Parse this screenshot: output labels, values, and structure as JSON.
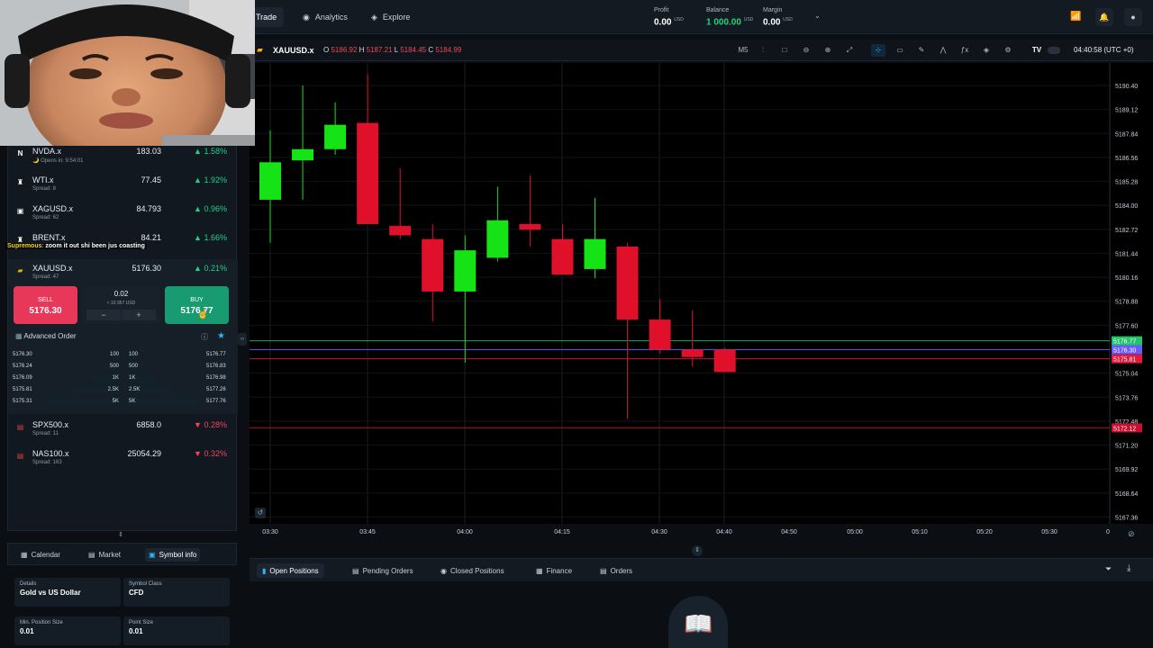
{
  "nav": {
    "tabs": [
      {
        "label": "Trade",
        "icon": "trade-icon"
      },
      {
        "label": "Analytics",
        "icon": "analytics-icon"
      },
      {
        "label": "Explore",
        "icon": "explore-icon"
      }
    ]
  },
  "account": {
    "profit_label": "Profit",
    "profit_value": "0.00",
    "profit_ccy": "USD",
    "balance_label": "Balance",
    "balance_value": "1 000.00",
    "balance_ccy": "USD",
    "margin_label": "Margin",
    "margin_value": "0.00",
    "margin_ccy": "USD"
  },
  "webcam": {
    "comment_user": "Supremous",
    "comment_text": "zoom it out shi been jus coasting"
  },
  "watchlist": [
    {
      "symbol": "NVDA.x",
      "sub": "Opens in: 9:54:01",
      "price": "183.03",
      "change": "1.58%",
      "dir": "up",
      "icon": "N"
    },
    {
      "symbol": "WTI.x",
      "sub": "Spread: 8",
      "price": "77.45",
      "change": "1.92%",
      "dir": "up",
      "icon": "♜"
    },
    {
      "symbol": "XAGUSD.x",
      "sub": "Spread: 62",
      "price": "84.793",
      "change": "0.96%",
      "dir": "up",
      "icon": "▣"
    },
    {
      "symbol": "BRENT.x",
      "sub": "",
      "price": "84.21",
      "change": "1.66%",
      "dir": "up",
      "icon": "♜"
    },
    {
      "symbol": "XAUUSD.x",
      "sub": "Spread: 47",
      "price": "5176.30",
      "change": "0.21%",
      "dir": "up",
      "icon": "▰"
    }
  ],
  "watchlist_after": [
    {
      "symbol": "SPX500.x",
      "sub": "Spread: 11",
      "price": "6858.0",
      "change": "0.28%",
      "dir": "down",
      "icon": "▤"
    },
    {
      "symbol": "NAS100.x",
      "sub": "Spread: 163",
      "price": "25054.29",
      "change": "0.32%",
      "dir": "down",
      "icon": "▤"
    }
  ],
  "trade": {
    "sell_label": "SELL",
    "sell_price": "5176.30",
    "buy_label": "BUY",
    "buy_price": "5176.77",
    "qty": "0.02",
    "qty_usd": "≈ 10 357 USD",
    "minus": "−",
    "plus": "+",
    "advanced_label": "Advanced Order"
  },
  "orderbook": [
    {
      "bid": "5176.30",
      "bvol": "100",
      "avol": "100",
      "ask": "5176.77"
    },
    {
      "bid": "5176.24",
      "bvol": "500",
      "avol": "500",
      "ask": "5176.83"
    },
    {
      "bid": "5176.09",
      "bvol": "1K",
      "avol": "1K",
      "ask": "5176.98"
    },
    {
      "bid": "5175.81",
      "bvol": "2.5K",
      "avol": "2.5K",
      "ask": "5177.26"
    },
    {
      "bid": "5175.31",
      "bvol": "5K",
      "avol": "5K",
      "ask": "5177.76"
    }
  ],
  "bottom_tabs": [
    "Calendar",
    "Market",
    "Symbol info"
  ],
  "symbol_info": {
    "details_label": "Details",
    "details_value": "Gold vs US Dollar",
    "class_label": "Symbol Class",
    "class_value": "CFD",
    "minpos_label": "Min. Position Size",
    "minpos_value": "0.01",
    "point_label": "Point Size",
    "point_value": "0.01"
  },
  "chart_header": {
    "symbol": "XAUUSD.x",
    "o_label": "O",
    "o": "5186.92",
    "h_label": "H",
    "h": "5187.21",
    "l_label": "L",
    "l": "5184.45",
    "c_label": "C",
    "c": "5184.99",
    "timeframe": "M5",
    "clock": "04:40:58 (UTC +0)"
  },
  "position_tabs": [
    "Open Positions",
    "Pending Orders",
    "Closed Positions",
    "Finance",
    "Orders"
  ],
  "chart_data": {
    "type": "candlestick",
    "x": [
      "03:30",
      "03:35",
      "03:40",
      "03:45",
      "03:50",
      "03:55",
      "04:00",
      "04:05",
      "04:10",
      "04:15",
      "04:20",
      "04:25",
      "04:30",
      "04:35",
      "04:40"
    ],
    "candles": [
      {
        "o": 5184.3,
        "h": 5188.0,
        "l": 5182.0,
        "c": 5186.3
      },
      {
        "o": 5186.4,
        "h": 5190.4,
        "l": 5184.3,
        "c": 5187.0
      },
      {
        "o": 5187.0,
        "h": 5189.5,
        "l": 5186.7,
        "c": 5188.3
      },
      {
        "o": 5188.4,
        "h": 5191.0,
        "l": 5183.5,
        "c": 5183.0
      },
      {
        "o": 5182.9,
        "h": 5186.0,
        "l": 5182.2,
        "c": 5182.4
      },
      {
        "o": 5182.2,
        "h": 5183.0,
        "l": 5177.8,
        "c": 5179.4
      },
      {
        "o": 5179.4,
        "h": 5182.4,
        "l": 5175.6,
        "c": 5181.6
      },
      {
        "o": 5181.2,
        "h": 5185.0,
        "l": 5181.0,
        "c": 5183.2
      },
      {
        "o": 5183.0,
        "h": 5185.6,
        "l": 5181.8,
        "c": 5182.7
      },
      {
        "o": 5182.2,
        "h": 5183.0,
        "l": 5181.2,
        "c": 5180.3
      },
      {
        "o": 5180.6,
        "h": 5184.4,
        "l": 5180.1,
        "c": 5182.2
      },
      {
        "o": 5181.8,
        "h": 5182.0,
        "l": 5172.6,
        "c": 5177.9
      },
      {
        "o": 5177.9,
        "h": 5179.0,
        "l": 5176.1,
        "c": 5176.3
      },
      {
        "o": 5176.3,
        "h": 5178.4,
        "l": 5175.4,
        "c": 5175.9
      },
      {
        "o": 5176.3,
        "h": 5176.4,
        "l": 5175.2,
        "c": 5175.1
      }
    ],
    "y_ticks": [
      "5190.40",
      "5189.12",
      "5187.84",
      "5186.56",
      "5185.28",
      "5184.00",
      "5182.72",
      "5181.44",
      "5180.16",
      "5178.88",
      "5177.60",
      "5176.32",
      "5175.04",
      "5173.76",
      "5172.48",
      "5171.20",
      "5169.92",
      "5168.64",
      "5167.36"
    ],
    "x_ticks": [
      "03:30",
      "03:45",
      "04:00",
      "04:15",
      "04:30",
      "04:40",
      "04:50",
      "05:00",
      "05:10",
      "05:20",
      "05:30",
      "0"
    ],
    "ylim": [
      5167.0,
      5191.6
    ],
    "price_lines": [
      {
        "label": "5176.77",
        "value": 5176.77,
        "color": "#21c46a"
      },
      {
        "label": "5176.30",
        "value": 5176.3,
        "color": "#6a5bff"
      },
      {
        "label": "5175.81",
        "value": 5175.81,
        "color": "#e21b3c"
      },
      {
        "label": "5172.12",
        "value": 5172.12,
        "color": "#c8102e"
      }
    ],
    "up_color": "#16e316",
    "down_color": "#e0102a"
  }
}
